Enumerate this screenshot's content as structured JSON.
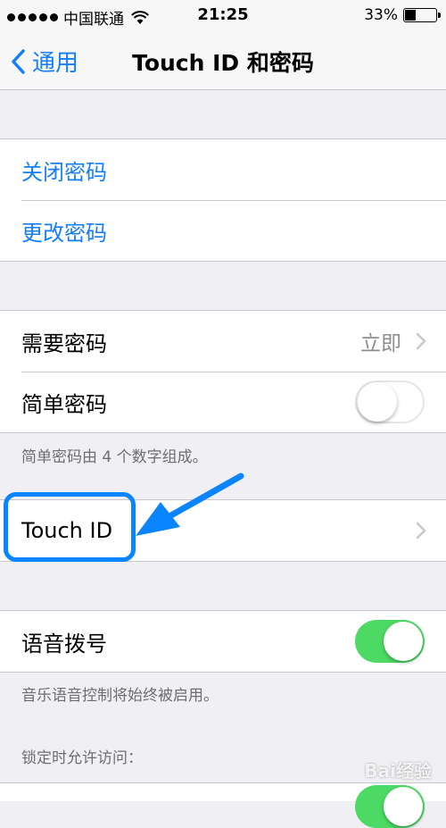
{
  "status_bar": {
    "carrier": "中国联通",
    "time": "21:25",
    "battery_percent": "33%",
    "battery_level": 0.33,
    "signal_icon": "signal-dots-icon",
    "wifi_icon": "wifi-icon"
  },
  "nav": {
    "back_label": "通用",
    "title": "Touch ID 和密码"
  },
  "group1": {
    "turn_off_passcode": "关闭密码",
    "change_passcode": "更改密码"
  },
  "group2": {
    "require_passcode_label": "需要密码",
    "require_passcode_value": "立即",
    "simple_passcode_label": "简单密码",
    "simple_passcode_on": false,
    "note": "简单密码由 4 个数字组成。"
  },
  "group3": {
    "touch_id_label": "Touch ID"
  },
  "group4": {
    "voice_dial_label": "语音拨号",
    "voice_dial_on": true,
    "note": "音乐语音控制将始终被启用。"
  },
  "locked_header": "锁定时允许访问：",
  "watermark": "Bai经验",
  "colors": {
    "accent": "#147efb",
    "toggle_on": "#4cd964",
    "annotation": "#0a84ff"
  }
}
